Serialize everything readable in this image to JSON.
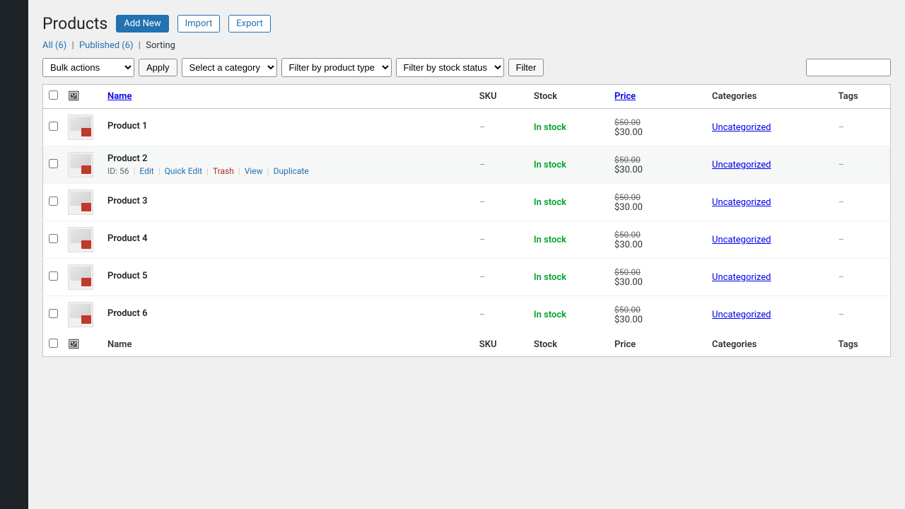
{
  "page": {
    "title": "Products",
    "add_new": "Add New",
    "import": "Import",
    "export": "Export"
  },
  "filters": {
    "views": [
      {
        "label": "All",
        "count": "(6)",
        "active": false
      },
      {
        "label": "Published",
        "count": "(6)",
        "active": false
      },
      {
        "label": "Sorting",
        "active": true
      }
    ],
    "bulk_actions_placeholder": "Bulk actions",
    "apply_label": "Apply",
    "category_placeholder": "Select a category",
    "product_type_placeholder": "Filter by product type",
    "stock_status_placeholder": "Filter by stock status",
    "filter_label": "Filter"
  },
  "table": {
    "columns": {
      "name": "Name",
      "sku": "SKU",
      "stock": "Stock",
      "price": "Price",
      "categories": "Categories",
      "tags": "Tags"
    },
    "products": [
      {
        "id": 1,
        "name": "Product 1",
        "sku": "–",
        "stock": "In stock",
        "price_original": "$50.00",
        "price_sale": "$30.00",
        "categories": "Uncategorized",
        "tags": "–",
        "row_id": ""
      },
      {
        "id": 56,
        "name": "Product 2",
        "sku": "–",
        "stock": "In stock",
        "price_original": "$50.00",
        "price_sale": "$30.00",
        "categories": "Uncategorized",
        "tags": "–",
        "row_id": "ID: 56",
        "hovered": true,
        "actions": {
          "edit": "Edit",
          "quick_edit": "Quick Edit",
          "trash": "Trash",
          "view": "View",
          "duplicate": "Duplicate"
        }
      },
      {
        "id": 3,
        "name": "Product 3",
        "sku": "–",
        "stock": "In stock",
        "price_original": "$50.00",
        "price_sale": "$30.00",
        "categories": "Uncategorized",
        "tags": "–",
        "row_id": ""
      },
      {
        "id": 4,
        "name": "Product 4",
        "sku": "–",
        "stock": "In stock",
        "price_original": "$50.00",
        "price_sale": "$30.00",
        "categories": "Uncategorized",
        "tags": "–",
        "row_id": ""
      },
      {
        "id": 5,
        "name": "Product 5",
        "sku": "–",
        "stock": "In stock",
        "price_original": "$50.00",
        "price_sale": "$30.00",
        "categories": "Uncategorized",
        "tags": "–",
        "row_id": ""
      },
      {
        "id": 6,
        "name": "Product 6",
        "sku": "",
        "stock": "In stock",
        "price_original": "$50.00",
        "price_sale": "$30.00",
        "categories": "Uncategorized",
        "tags": "",
        "row_id": ""
      }
    ],
    "footer_columns": {
      "name": "Name",
      "sku": "SKU",
      "stock": "Stock",
      "price": "Price",
      "categories": "Categories",
      "tags": "Tags"
    }
  }
}
